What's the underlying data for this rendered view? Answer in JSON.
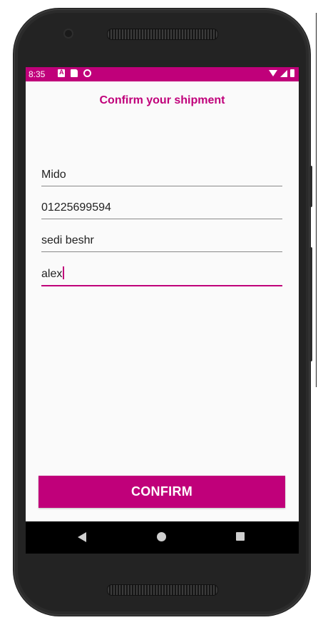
{
  "status_bar": {
    "time": "8:35",
    "left_icons": [
      "a-icon",
      "sd-card-icon",
      "sync-icon"
    ],
    "right_icons": [
      "wifi-icon",
      "signal-icon",
      "battery-icon"
    ]
  },
  "screen": {
    "title": "Confirm your shipment",
    "fields": [
      {
        "value": "Mido"
      },
      {
        "value": "01225699594"
      },
      {
        "value": "sedi beshr"
      },
      {
        "value": "alex",
        "focused": true
      }
    ],
    "confirm_label": "CONFIRM"
  },
  "nav": {
    "buttons": [
      "back-icon",
      "home-icon",
      "recents-icon"
    ]
  },
  "colors": {
    "accent": "#c0007a",
    "background": "#fafafa",
    "frame": "#2b2b2b"
  }
}
